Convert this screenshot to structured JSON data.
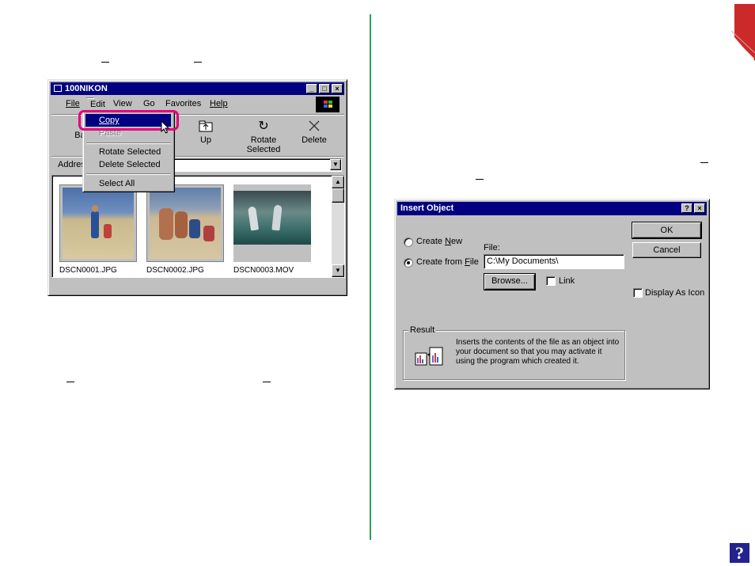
{
  "explorer": {
    "title": "100NIKON",
    "menu": [
      "File",
      "Edit",
      "View",
      "Go",
      "Favorites",
      "Help"
    ],
    "toolbar": {
      "back": "Ba",
      "up": "Up",
      "rotate": "Rotate Selected",
      "delete": "Delete"
    },
    "address_label": "Addres",
    "edit_menu": {
      "copy": "Copy",
      "paste": "Paste",
      "rotate": "Rotate Selected",
      "delete": "Delete Selected",
      "select_all": "Select All"
    },
    "files": [
      "DSCN0001.JPG",
      "DSCN0002.JPG",
      "DSCN0003.MOV"
    ],
    "highlight_color": "#e6007e"
  },
  "dialog": {
    "title": "Insert Object",
    "create_new": "Create New",
    "create_from_file": "Create from File",
    "file_label": "File:",
    "file_value": "C:\\My Documents\\",
    "browse": "Browse...",
    "link": "Link",
    "ok": "OK",
    "cancel": "Cancel",
    "display_as_icon": "Display As Icon",
    "result_label": "Result",
    "result_text": "Inserts the contents of the file as an object into your document so that you may activate it using the program which created it."
  },
  "help_icon": "?",
  "colors": {
    "divider": "#2f9e5a",
    "corner": "#cc2a2a",
    "help": "#23238e",
    "titlebar": "#000080"
  }
}
